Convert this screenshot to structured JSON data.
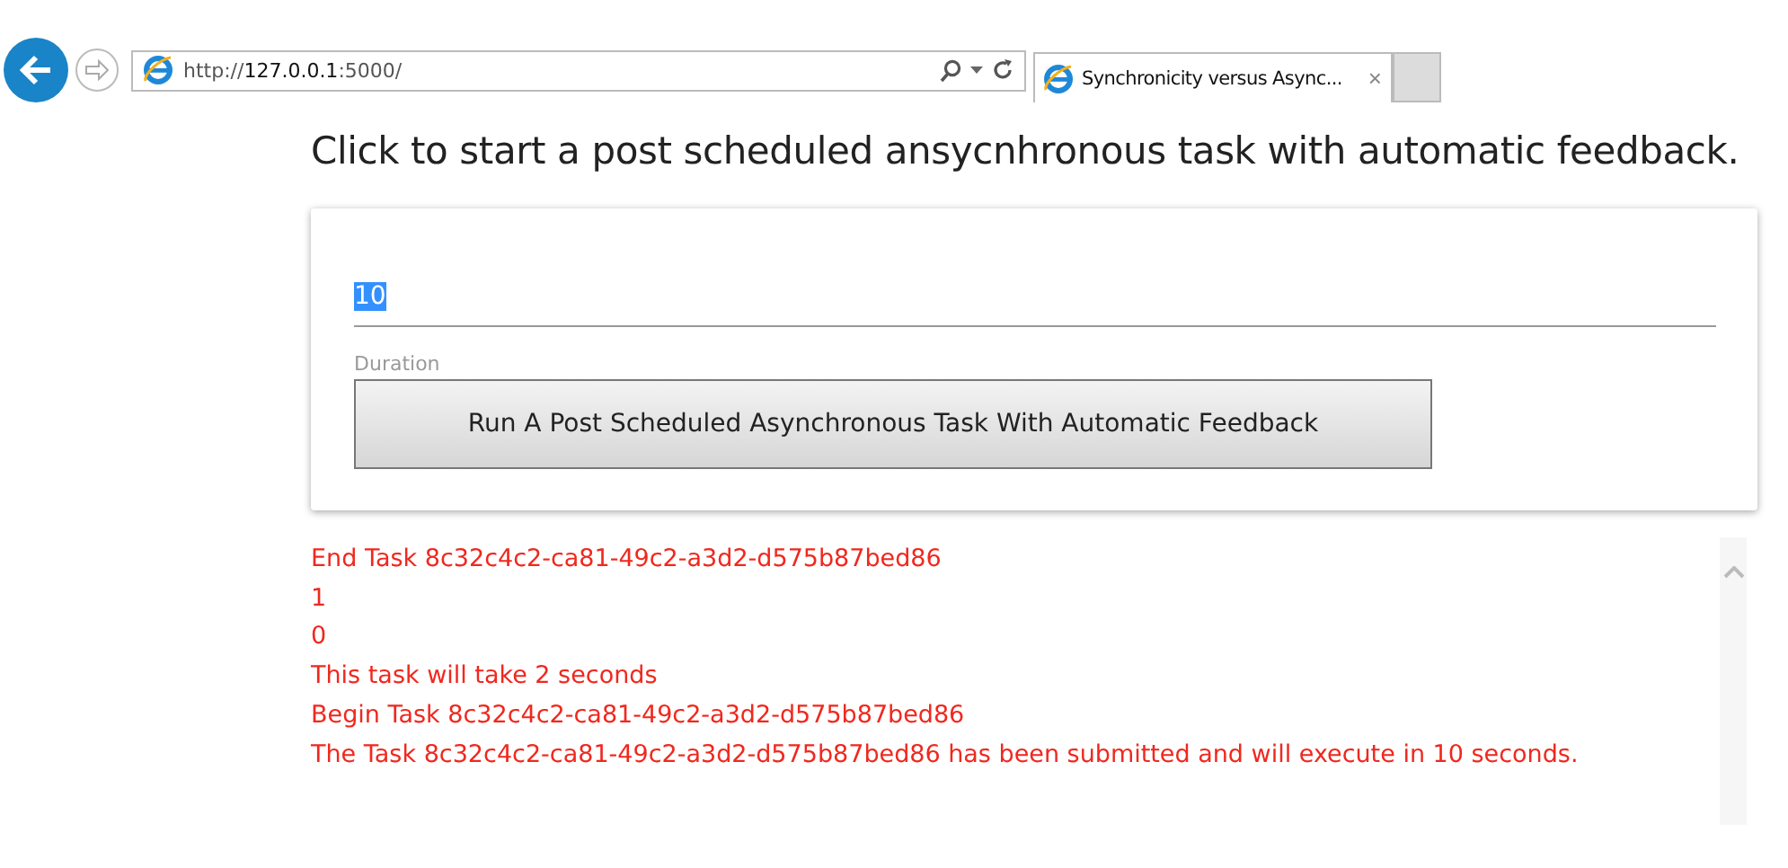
{
  "browser": {
    "address": {
      "scheme": "http://",
      "host": "127.0.0.1",
      "path": ":5000/"
    },
    "tab": {
      "title": "Synchronicity versus Async...",
      "close": "×",
      "selected": true
    }
  },
  "heading": "Click to start a post scheduled ansycnhronous task with automatic feedback.",
  "form": {
    "field": {
      "value": "10",
      "value_selected": true,
      "label": "Duration"
    },
    "button": "Run A Post Scheduled Asynchronous Task With Automatic Feedback"
  },
  "log": [
    "End Task 8c32c4c2-ca81-49c2-a3d2-d575b87bed86",
    "1",
    "0",
    "This task will take 2 seconds",
    "Begin Task 8c32c4c2-ca81-49c2-a3d2-d575b87bed86",
    "The Task 8c32c4c2-ca81-49c2-a3d2-d575b87bed86 has been submitted and will execute in 10 seconds."
  ]
}
